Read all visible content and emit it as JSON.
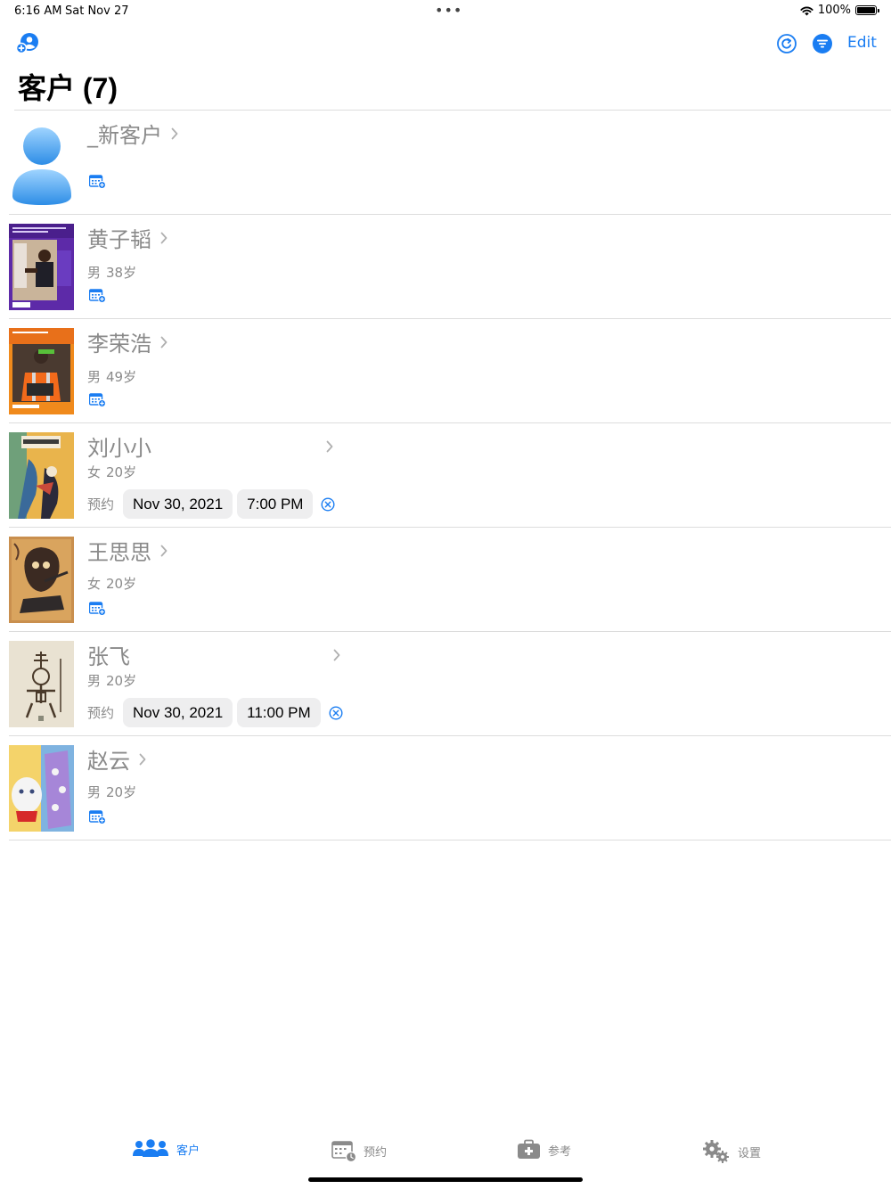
{
  "status": {
    "time": "6:16 AM",
    "date": "Sat Nov 27",
    "dots": "•••",
    "battery": "100%"
  },
  "nav": {
    "title": "客户 (7)",
    "edit_label": "Edit"
  },
  "appt_label": "预约",
  "clients": [
    {
      "name": "_新客户",
      "gender": "",
      "age": "",
      "appointment": null
    },
    {
      "name": "黄子韬",
      "gender": "男",
      "age": "38岁",
      "appointment": null
    },
    {
      "name": "李荣浩",
      "gender": "男",
      "age": "49岁",
      "appointment": null
    },
    {
      "name": "刘小小",
      "gender": "女",
      "age": "20岁",
      "appointment": {
        "date": "Nov 30, 2021",
        "time": "7:00 PM"
      }
    },
    {
      "name": "王思思",
      "gender": "女",
      "age": "20岁",
      "appointment": null
    },
    {
      "name": "张飞",
      "gender": "男",
      "age": "20岁",
      "appointment": {
        "date": "Nov 30, 2021",
        "time": "11:00 PM"
      }
    },
    {
      "name": "赵云",
      "gender": "男",
      "age": "20岁",
      "appointment": null
    }
  ],
  "tabs": [
    {
      "label": "客户"
    },
    {
      "label": "预约"
    },
    {
      "label": "参考"
    },
    {
      "label": "设置"
    }
  ],
  "colors": {
    "accent": "#1a7df2",
    "gray_text": "#8a8a8a",
    "divider": "#dcdcdc"
  }
}
